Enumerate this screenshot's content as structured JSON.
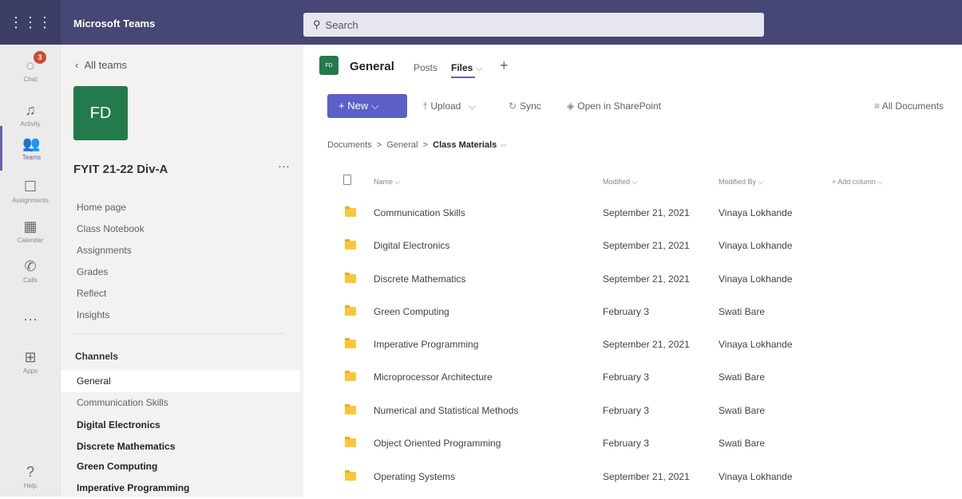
{
  "app": {
    "title": "Microsoft Teams",
    "apps_icon": "apps-grid-icon"
  },
  "search": {
    "placeholder": "Search"
  },
  "rail": {
    "items": [
      {
        "label": "Chat",
        "icon": "chat-icon",
        "badge": "3"
      },
      {
        "label": "Activity",
        "icon": "bell-icon"
      },
      {
        "label": "Teams",
        "icon": "teams-icon",
        "active": true
      },
      {
        "label": "Assignments",
        "icon": "assignments-icon"
      },
      {
        "label": "Calendar",
        "icon": "calendar-icon"
      },
      {
        "label": "Calls",
        "icon": "phone-icon"
      },
      {
        "label": "",
        "icon": "more-icon"
      },
      {
        "label": "Apps",
        "icon": "apps-icon"
      },
      {
        "label": "Help",
        "icon": "help-icon"
      }
    ]
  },
  "team": {
    "back_label": "All teams",
    "avatar_initials": "FD",
    "name": "FYIT 21-22 Div-A",
    "more": "···",
    "menu": [
      "Home page",
      "Class Notebook",
      "Assignments",
      "Grades",
      "Reflect",
      "Insights"
    ],
    "channels_heading": "Channels",
    "channels": [
      {
        "name": "General",
        "selected": true,
        "bold": false
      },
      {
        "name": "Communication Skills",
        "selected": false,
        "bold": false
      },
      {
        "name": "Digital Electronics",
        "selected": false,
        "bold": true
      },
      {
        "name": "Discrete Mathematics",
        "selected": false,
        "bold": true
      },
      {
        "name": "Green Computing",
        "selected": false,
        "bold": true
      },
      {
        "name": "Imperative Programming",
        "selected": false,
        "bold": true
      }
    ]
  },
  "channel": {
    "avatar_initials": "FD",
    "title": "General",
    "tabs": {
      "posts": "Posts",
      "files": "Files",
      "files_chevron": "⌵"
    },
    "add_tab": "+"
  },
  "toolbar": {
    "new_label": "+ New ⌵",
    "upload_label": "Upload",
    "sync_label": "Sync",
    "sharepoint_label": "Open in SharePoint",
    "view_label": "All Documents"
  },
  "breadcrumb": {
    "part1": "Documents",
    "part2": "General",
    "part3": "Class Materials",
    "sep": ">"
  },
  "table": {
    "headers": {
      "name": "Name ⌵",
      "modified": "Modified ⌵",
      "modified_by": "Modified By ⌵",
      "add_column": "+ Add column ⌵"
    },
    "rows": [
      {
        "name": "Communication Skills",
        "modified": "September 21, 2021",
        "modified_by": "Vinaya Lokhande"
      },
      {
        "name": "Digital Electronics",
        "modified": "September 21, 2021",
        "modified_by": "Vinaya Lokhande"
      },
      {
        "name": "Discrete Mathematics",
        "modified": "September 21, 2021",
        "modified_by": "Vinaya Lokhande"
      },
      {
        "name": "Green Computing",
        "modified": "February 3",
        "modified_by": "Swati Bare"
      },
      {
        "name": "Imperative Programming",
        "modified": "September 21, 2021",
        "modified_by": "Vinaya Lokhande"
      },
      {
        "name": "Microprocessor Architecture",
        "modified": "February 3",
        "modified_by": "Swati Bare"
      },
      {
        "name": "Numerical and Statistical Methods",
        "modified": "February 3",
        "modified_by": "Swati Bare"
      },
      {
        "name": "Object Oriented Programming",
        "modified": "February 3",
        "modified_by": "Swati Bare"
      },
      {
        "name": "Operating Systems",
        "modified": "September 21, 2021",
        "modified_by": "Vinaya Lokhande"
      }
    ]
  },
  "colors": {
    "brand": "#464775",
    "accent": "#5b5fc7",
    "team_green": "#237b4b",
    "folder": "#fcc63b"
  }
}
